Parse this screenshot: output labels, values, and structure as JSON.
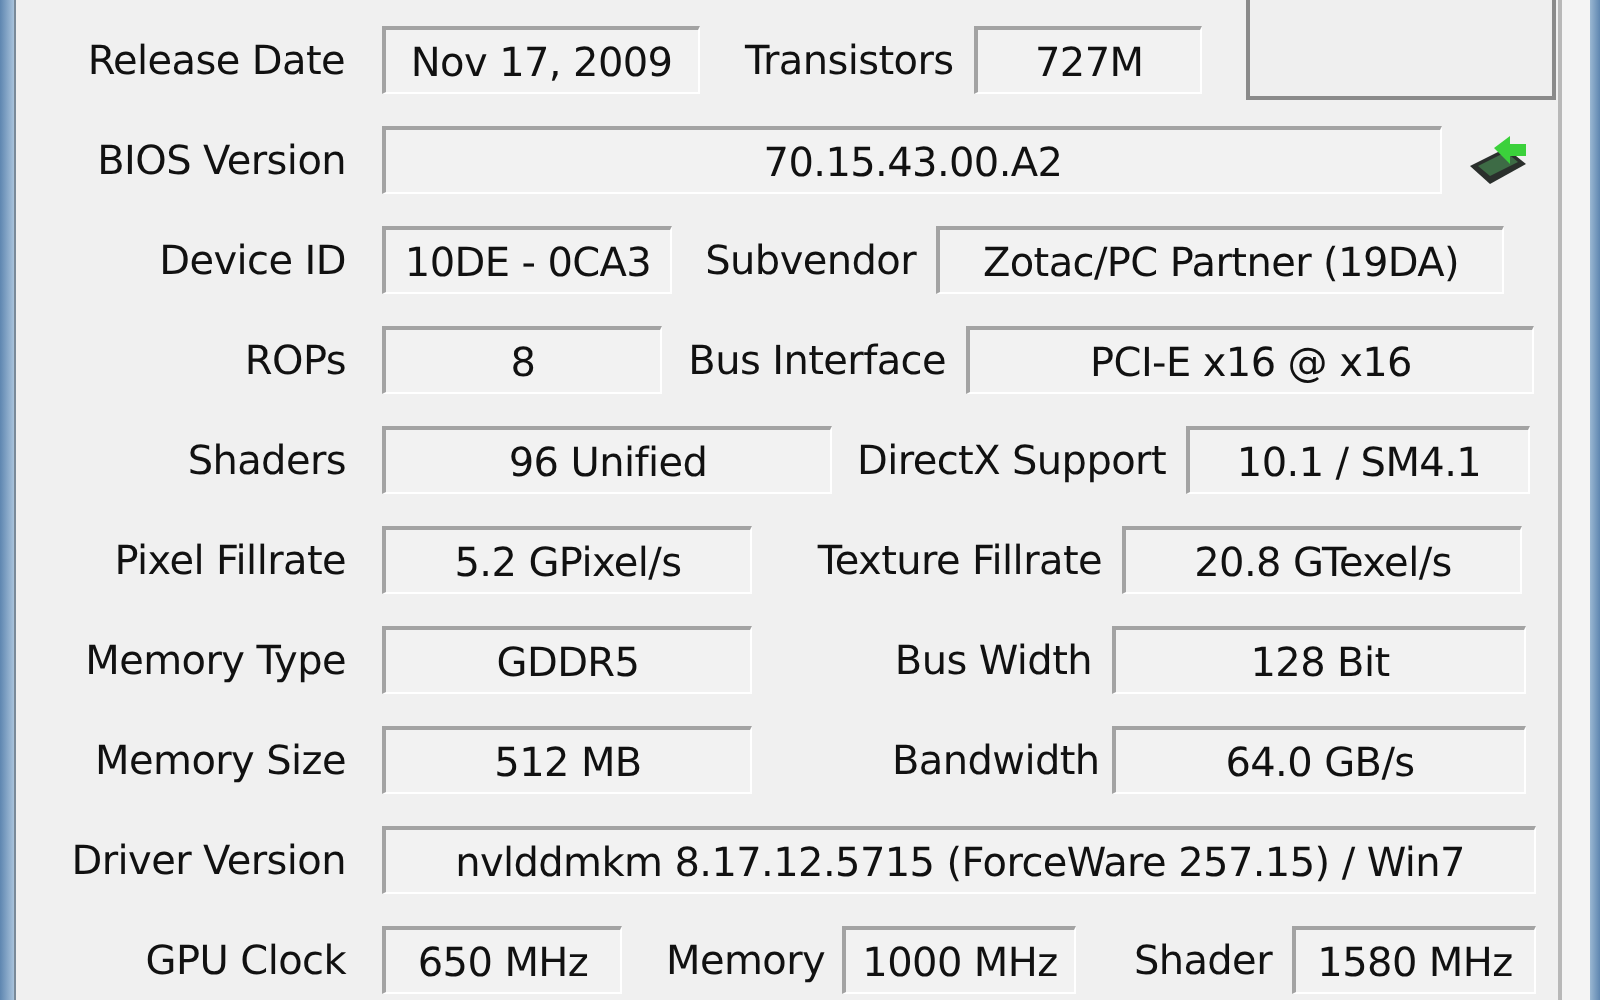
{
  "rows": [
    {
      "items": [
        {
          "label": "Release Date",
          "value": "Nov 17, 2009"
        },
        {
          "label": "Transistors",
          "value": "727M"
        }
      ]
    },
    {
      "items": [
        {
          "label": "BIOS Version",
          "value": "70.15.43.00.A2"
        }
      ]
    },
    {
      "items": [
        {
          "label": "Device ID",
          "value": "10DE - 0CA3"
        },
        {
          "label": "Subvendor",
          "value": "Zotac/PC Partner (19DA)"
        }
      ]
    },
    {
      "items": [
        {
          "label": "ROPs",
          "value": "8"
        },
        {
          "label": "Bus Interface",
          "value": "PCI-E x16 @ x16"
        }
      ]
    },
    {
      "items": [
        {
          "label": "Shaders",
          "value": "96 Unified"
        },
        {
          "label": "DirectX Support",
          "value": "10.1 / SM4.1"
        }
      ]
    },
    {
      "items": [
        {
          "label": "Pixel Fillrate",
          "value": "5.2 GPixel/s"
        },
        {
          "label": "Texture Fillrate",
          "value": "20.8 GTexel/s"
        }
      ]
    },
    {
      "items": [
        {
          "label": "Memory Type",
          "value": "GDDR5"
        },
        {
          "label": "Bus Width",
          "value": "128 Bit"
        }
      ]
    },
    {
      "items": [
        {
          "label": "Memory Size",
          "value": "512 MB"
        },
        {
          "label": "Bandwidth",
          "value": "64.0 GB/s"
        }
      ]
    },
    {
      "items": [
        {
          "label": "Driver Version",
          "value": "nvlddmkm 8.17.12.5715 (ForceWare 257.15) / Win7"
        }
      ]
    },
    {
      "items": [
        {
          "label": "GPU Clock",
          "value": "650 MHz"
        },
        {
          "label": "Memory",
          "value": "1000 MHz"
        },
        {
          "label": "Shader",
          "value": "1580 MHz"
        }
      ]
    }
  ]
}
